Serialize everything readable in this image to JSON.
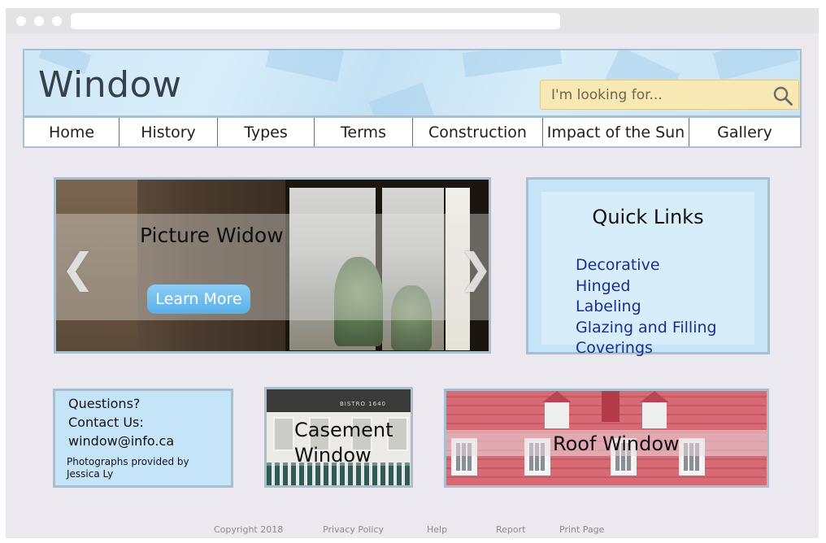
{
  "site": {
    "title": "Window"
  },
  "search": {
    "placeholder": "I'm looking for..."
  },
  "nav": {
    "items": [
      {
        "label": "Home"
      },
      {
        "label": "History"
      },
      {
        "label": "Types"
      },
      {
        "label": "Terms"
      },
      {
        "label": "Construction"
      },
      {
        "label": "Impact of the Sun"
      },
      {
        "label": "Gallery"
      }
    ]
  },
  "slider": {
    "title": "Picture Widow",
    "button_label": "Learn More",
    "prev_icon": "❮",
    "next_icon": "❯"
  },
  "quick_links": {
    "title": "Quick Links",
    "items": [
      "Decorative",
      "Hinged",
      "Labeling",
      "Glazing and Filling",
      "Coverings"
    ]
  },
  "contact": {
    "questions": "Questions?",
    "contact_us": "Contact Us:",
    "email": "window@info.ca",
    "photo_credit": "Photographs provided by Jessica Ly"
  },
  "tiles": {
    "casement": {
      "label_line1": "Casement",
      "label_line2": "Window",
      "sign_text": "BISTRO 1640"
    },
    "roof": {
      "label": "Roof Window"
    }
  },
  "footer": {
    "links": [
      "Copyright 2018",
      "Privacy Policy",
      "Help",
      "Report",
      "Print Page"
    ]
  }
}
